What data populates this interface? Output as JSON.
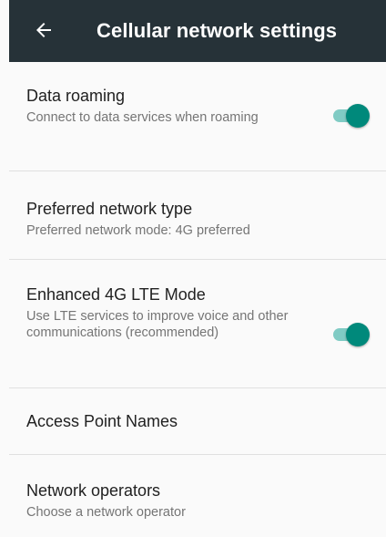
{
  "app_bar": {
    "title": "Cellular network settings",
    "back_icon": "arrow-left-icon",
    "background_color": "#263238"
  },
  "settings": [
    {
      "title": "Data roaming",
      "summary": "Connect to data services when roaming",
      "toggle": true,
      "checked": true
    },
    {
      "title": "Preferred network type",
      "summary": "Preferred network mode: 4G preferred",
      "toggle": false
    },
    {
      "title": "Enhanced 4G LTE Mode",
      "summary": "Use LTE services to improve voice and other communications (recommended)",
      "toggle": true,
      "checked": true
    },
    {
      "title": "Access Point Names",
      "summary": "",
      "toggle": false
    },
    {
      "title": "Network operators",
      "summary": "Choose a network operator",
      "toggle": false
    }
  ],
  "colors": {
    "accent": "#00897b",
    "accent_track": "#80cbc4",
    "background": "#fafafa",
    "divider": "#e0e0e0"
  }
}
